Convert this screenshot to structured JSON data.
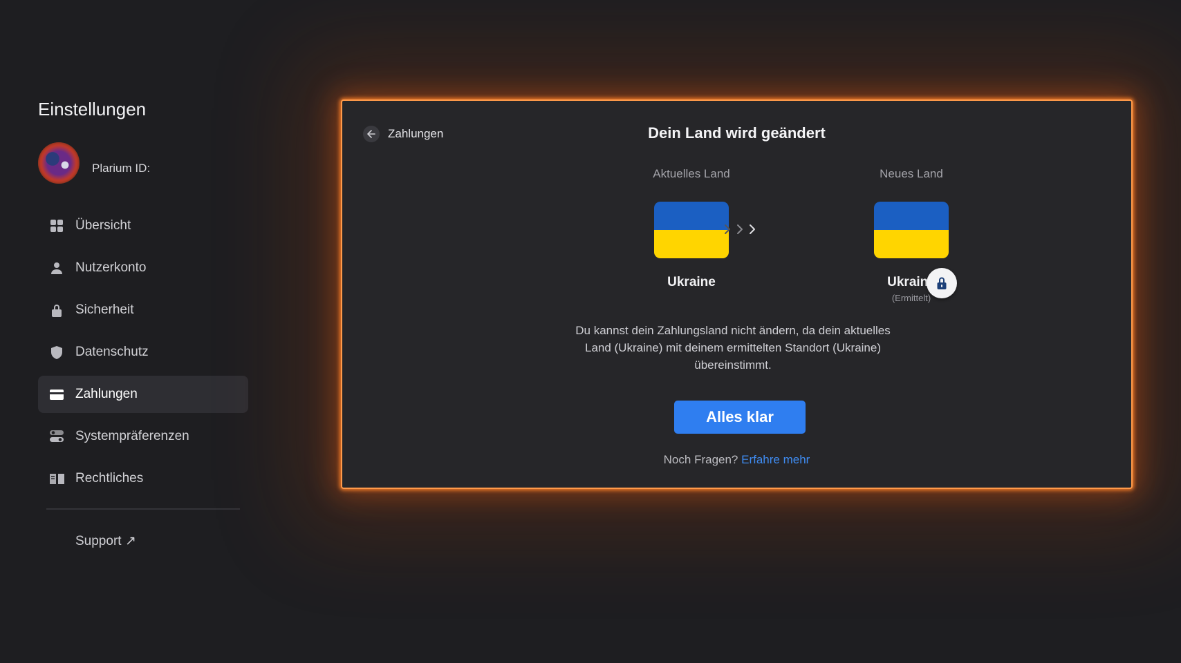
{
  "sidebar": {
    "title": "Einstellungen",
    "profile": {
      "label": "Plarium ID:"
    },
    "items": [
      {
        "label": "Übersicht",
        "icon": "grid-icon",
        "active": false
      },
      {
        "label": "Nutzerkonto",
        "icon": "user-icon",
        "active": false
      },
      {
        "label": "Sicherheit",
        "icon": "lock-icon",
        "active": false
      },
      {
        "label": "Datenschutz",
        "icon": "shield-icon",
        "active": false
      },
      {
        "label": "Zahlungen",
        "icon": "credit-card-icon",
        "active": true
      },
      {
        "label": "Systempräferenzen",
        "icon": "toggle-icon",
        "active": false
      },
      {
        "label": "Rechtliches",
        "icon": "book-icon",
        "active": false
      }
    ],
    "support": "Support ↗"
  },
  "panel": {
    "back_label": "Zahlungen",
    "title": "Dein Land wird geändert",
    "current": {
      "label": "Aktuelles Land",
      "country": "Ukraine"
    },
    "new": {
      "label": "Neues Land",
      "country": "Ukraine",
      "sub": "(Ermittelt)"
    },
    "message": "Du kannst dein Zahlungsland nicht ändern, da dein aktuelles Land (Ukraine) mit deinem ermittelten Standort (Ukraine) übereinstimmt.",
    "button": "Alles klar",
    "help_prefix": "Noch Fragen?",
    "help_link": "Erfahre mehr"
  },
  "colors": {
    "accent": "#2f7ef0",
    "glow": "#ff9a4a",
    "flag_blue": "#1b5fc2",
    "flag_yellow": "#ffd500"
  }
}
